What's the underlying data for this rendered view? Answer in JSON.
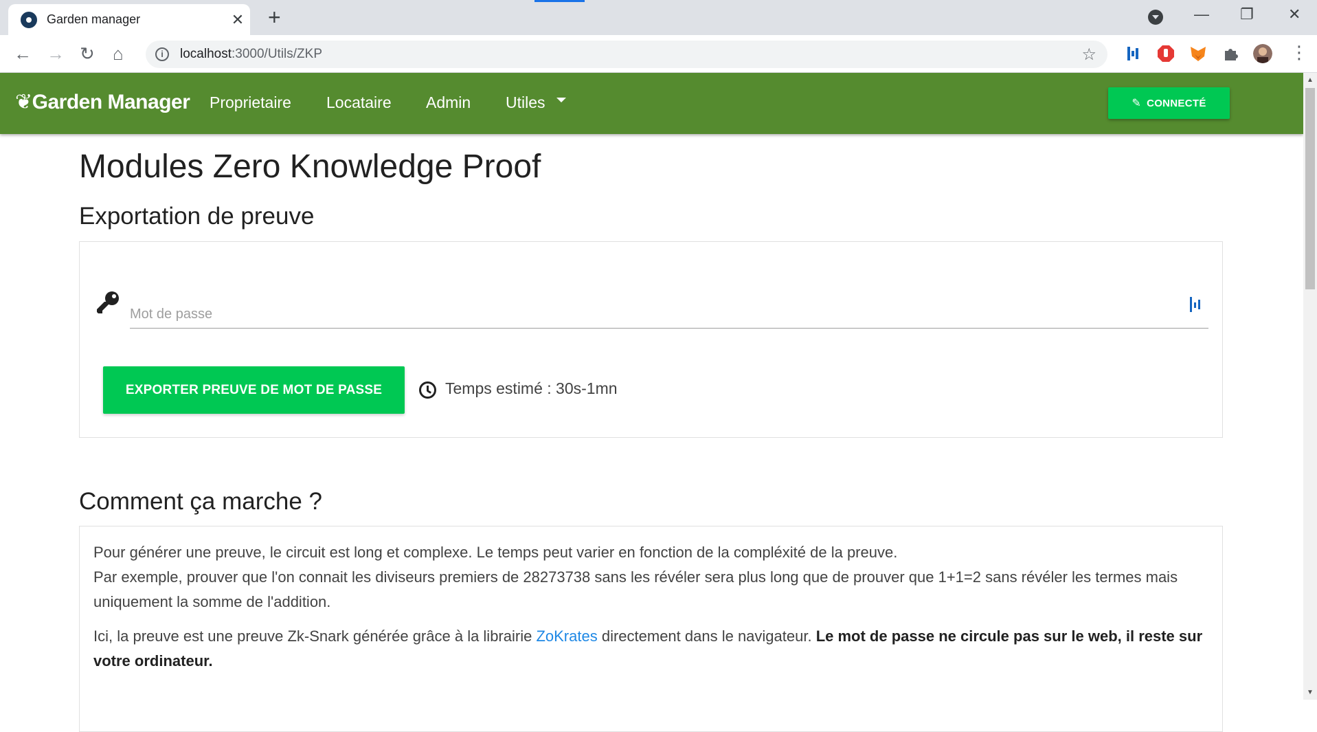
{
  "browser": {
    "tab_title": "Garden manager",
    "tab_close": "✕",
    "new_tab": "+",
    "url_host": "localhost",
    "url_path": ":3000/Utils/ZKP"
  },
  "navbar": {
    "brand": "Garden Manager",
    "links": [
      "Proprietaire",
      "Locataire",
      "Admin",
      "Utiles"
    ],
    "connect_label": "CONNECTÉ",
    "color": "#558b2f",
    "button_color": "#00c853"
  },
  "page": {
    "title": "Modules Zero Knowledge Proof",
    "export_heading": "Exportation de preuve",
    "password_placeholder": "Mot de passe",
    "export_button": "EXPORTER PREUVE DE MOT DE PASSE",
    "estimate": "Temps estimé : 30s-1mn",
    "how_heading": "Comment ça marche ?",
    "para1_line1": "Pour générer une preuve, le circuit est long et complexe. Le temps peut varier en fonction de la compléxité de la preuve.",
    "para1_line2": "Par exemple, prouver que l'on connait les diviseurs premiers de 28273738 sans les révéler sera plus long que de prouver que 1+1=2 sans révéler les termes mais uniquement la somme de l'addition.",
    "para2_prefix": "Ici, la preuve est une preuve Zk-Snark générée grâce à la librairie ",
    "para2_link": "ZoKrates",
    "para2_middle": " directement dans le navigateur. ",
    "para2_bold": "Le mot de passe ne circule pas sur le web, il reste sur votre ordinateur."
  }
}
